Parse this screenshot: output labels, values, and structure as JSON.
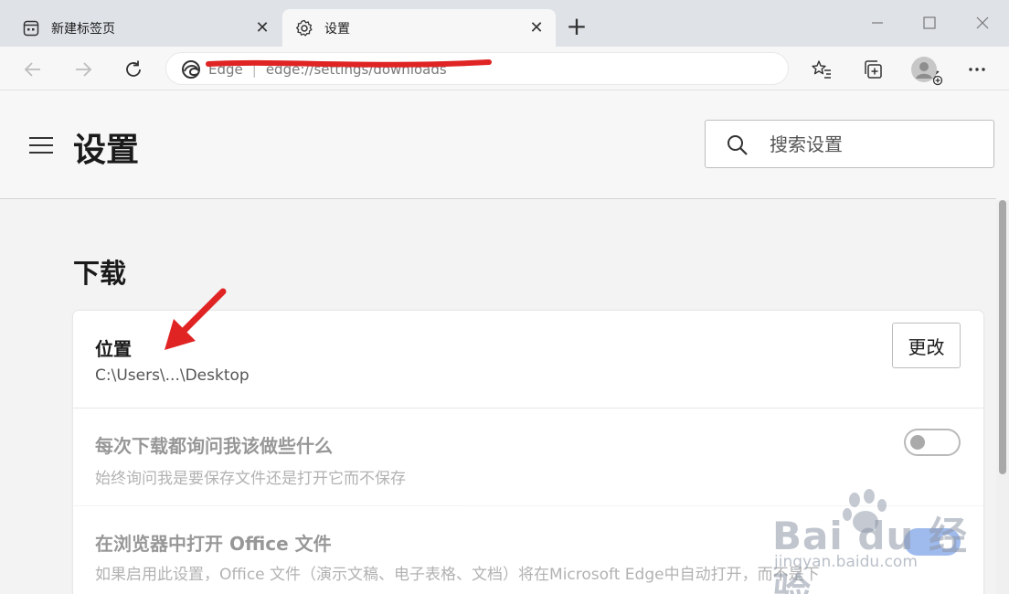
{
  "browser": {
    "tabs": [
      {
        "title": "新建标签页",
        "icon": "new-tab-page-icon",
        "active": false
      },
      {
        "title": "设置",
        "icon": "gear-icon",
        "active": true
      }
    ],
    "address": {
      "prefix": "Edge",
      "url": "edge://settings/downloads"
    },
    "close_glyph": "✕",
    "new_tab_glyph": "+"
  },
  "settings": {
    "title": "设置",
    "search_placeholder": "搜索设置",
    "section_title": "下载",
    "location": {
      "label": "位置",
      "path": "C:\\Users\\...\\Desktop",
      "change_button": "更改"
    },
    "ask_before_download": {
      "label": "每次下载都询问我该做些什么",
      "description": "始终询问我是要保存文件还是打开它而不保存",
      "toggle_on": false
    },
    "open_office": {
      "label": "在浏览器中打开 Office 文件",
      "description": "如果启用此设置，Office 文件（演示文稿、电子表格、文档）将在Microsoft Edge中自动打开，而不是下",
      "toggle_on": true
    }
  },
  "watermark": {
    "brand": "Bai  du 经验",
    "sub": "jingyan.baidu.com"
  },
  "colors": {
    "accent": "#2d6ad9",
    "annotation": "#e02424"
  }
}
